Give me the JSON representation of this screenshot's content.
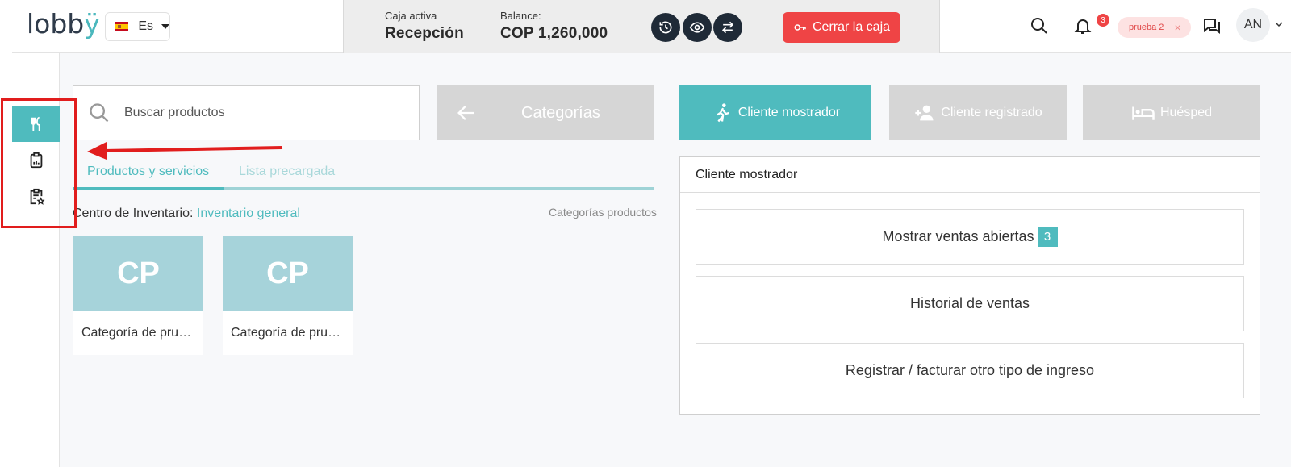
{
  "header": {
    "logo": {
      "text": "lobb",
      "accent": "ÿ"
    },
    "language": {
      "label": "Es"
    },
    "cash": {
      "active_label": "Caja activa",
      "active_value": "Recepción",
      "balance_label": "Balance:",
      "balance_value": "COP 1,260,000",
      "close_button": "Cerrar la caja"
    },
    "notifications_count": "3",
    "property_chip": {
      "label": "prueba 2",
      "close": "×"
    },
    "avatar_initials": "AN"
  },
  "sidebar": {
    "items": [
      {
        "icon": "utensils-icon",
        "active": true
      },
      {
        "icon": "clipboard-chart-icon",
        "active": false
      },
      {
        "icon": "clipboard-star-icon",
        "active": false
      }
    ]
  },
  "products": {
    "search_placeholder": "Buscar productos",
    "categories_button": "Categorías",
    "tabs": [
      {
        "label": "Productos y servicios",
        "active": true
      },
      {
        "label": "Lista precargada",
        "active": false
      }
    ],
    "inventory_label": "Centro de Inventario:",
    "inventory_link": "Inventario general",
    "categories_link": "Categorías productos",
    "cards": [
      {
        "initials": "CP",
        "name": "Categoría de prueba"
      },
      {
        "initials": "CP",
        "name": "Categoría de prueba"
      }
    ]
  },
  "client_types": [
    {
      "label": "Cliente mostrador",
      "icon": "walking-person-icon",
      "active": true
    },
    {
      "label": "Cliente registrado",
      "icon": "add-user-icon",
      "active": false
    },
    {
      "label": "Huésped",
      "icon": "bed-icon",
      "active": false
    }
  ],
  "client_panel": {
    "title": "Cliente mostrador",
    "actions": [
      {
        "label": "Mostrar ventas abiertas",
        "badge": "3"
      },
      {
        "label": "Historial de ventas"
      },
      {
        "label": "Registrar / facturar otro tipo de ingreso"
      }
    ]
  },
  "colors": {
    "accent": "#4fbbbe",
    "danger": "#ef4445",
    "disabled": "#d6d6d6",
    "annotation": "#e11d1d"
  }
}
